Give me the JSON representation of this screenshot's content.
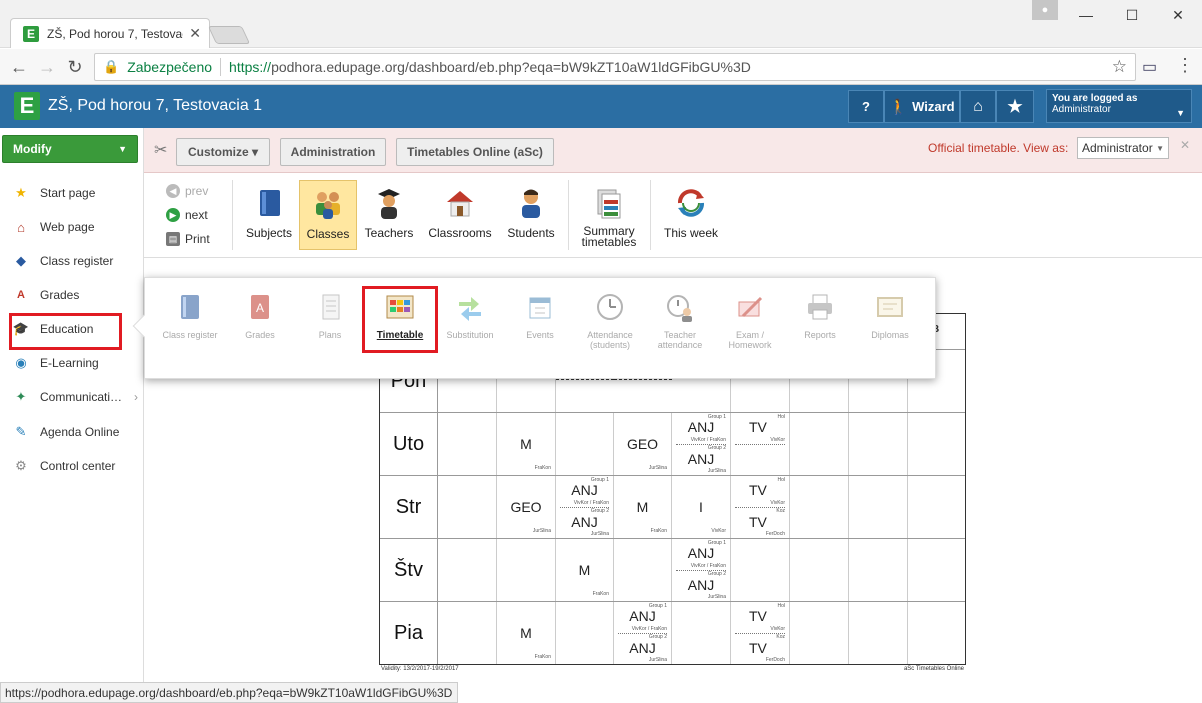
{
  "browser": {
    "tab_title": "ZŠ, Pod horou 7, Testovac",
    "tab_favicon": "E",
    "secure_label": "Zabezpečeno",
    "url_scheme": "https://",
    "url_rest": "podhora.edupage.org/dashboard/eb.php?eqa=bW9kZT10aW1ldGFibGU%3D",
    "status_url": "https://podhora.edupage.org/dashboard/eb.php?eqa=bW9kZT10aW1ldGFibGU%3D"
  },
  "app": {
    "logo": "E",
    "title": "ZŠ, Pod horou 7, Testovacia 1",
    "help_label": "?",
    "wizard_label": "Wizard",
    "logged_line1": "You are logged as",
    "logged_line2": "Administrator"
  },
  "sidebar": {
    "modify_label": "Modify",
    "items": [
      {
        "label": "Start page",
        "icon": "star-icon"
      },
      {
        "label": "Web page",
        "icon": "house-icon"
      },
      {
        "label": "Class register",
        "icon": "book-icon"
      },
      {
        "label": "Grades",
        "icon": "grades-icon"
      },
      {
        "label": "Education",
        "icon": "graduation-icon"
      },
      {
        "label": "E-Learning",
        "icon": "globe-icon"
      },
      {
        "label": "Communicati…",
        "icon": "chat-icon"
      },
      {
        "label": "Agenda Online",
        "icon": "pen-icon"
      },
      {
        "label": "Control center",
        "icon": "gear-icon"
      }
    ]
  },
  "toolbar": {
    "customize": "Customize ▾",
    "administration": "Administration",
    "timetables_online": "Timetables Online (aSc)",
    "official": "Official timetable.  View as:",
    "view_as": "Administrator"
  },
  "ribbon": {
    "prev": "prev",
    "next": "next",
    "print": "Print",
    "items": [
      "Subjects",
      "Classes",
      "Teachers",
      "Classrooms",
      "Students",
      "Summary timetables",
      "This week"
    ]
  },
  "popup": {
    "items": [
      "Class register",
      "Grades",
      "Plans",
      "Timetable",
      "Substitution",
      "Events",
      "Attendance (students)",
      "Teacher attendance",
      "Exam / Homework",
      "Reports",
      "Diplomas"
    ]
  },
  "timetable": {
    "days": [
      "Pon",
      "Uto",
      "Str",
      "Štv",
      "Pia"
    ],
    "footer_left": "Validity: 13/2/2017-19/2/2017",
    "footer_right": "aSc Timetables Online",
    "corner_tag": "B",
    "groups": {
      "g1": "Group 1",
      "g2": "Group 2",
      "hol": "Hol",
      "koz": "Koz"
    },
    "teachers": {
      "fra": "FraKon",
      "jur": "JurSlina",
      "viv": "VivKor",
      "vivfra": "VivKor / FraKon",
      "fer": "FerDoch"
    },
    "lessons": {
      "geo": "GEO",
      "anj": "ANJ",
      "m": "M",
      "tv": "TV",
      "i": "I"
    }
  },
  "colors": {
    "accent": "#2b6ea3",
    "highlight": "#e11b22",
    "green": "#3a9a3a"
  }
}
